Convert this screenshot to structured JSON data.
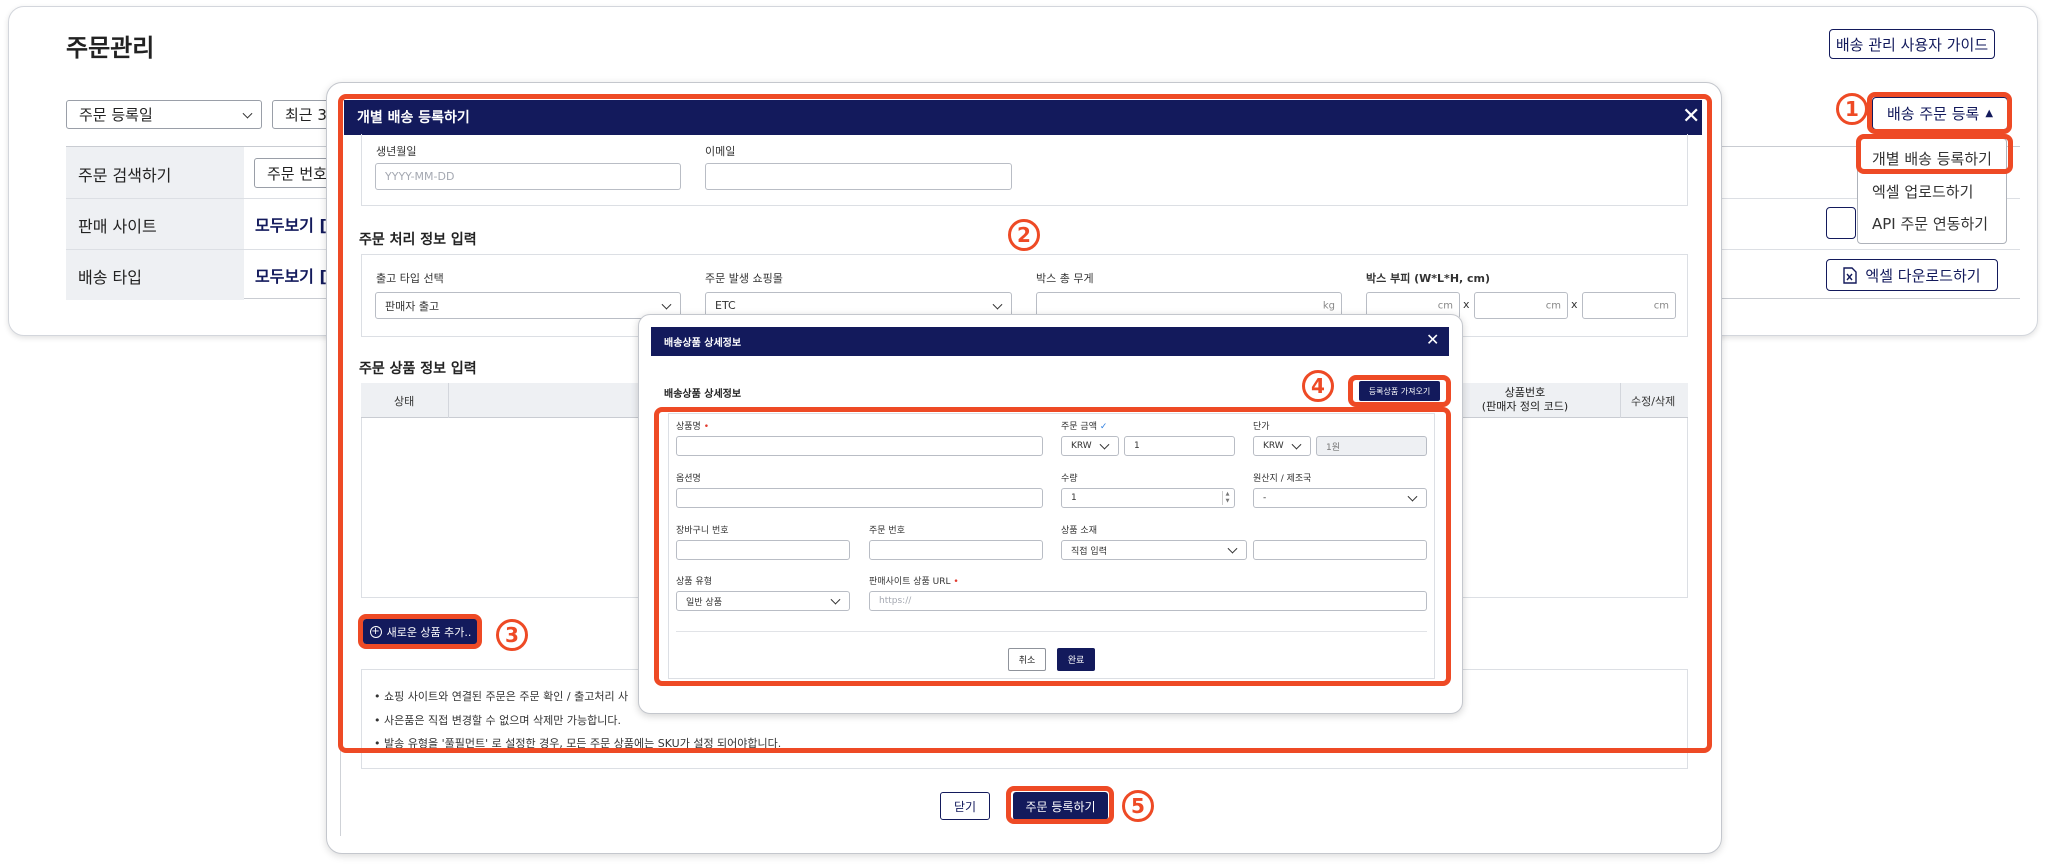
{
  "page": {
    "title": "주문관리",
    "guide_button": "배송 관리 사용자 가이드",
    "filter": {
      "date_type": "주문 등록일",
      "period_partial": "최근 3"
    },
    "search_rows": [
      {
        "label": "주문 검색하기",
        "value": "주문 번호"
      },
      {
        "label": "판매 사이트",
        "value": "모두보기 ["
      },
      {
        "label": "배송 타입",
        "value": "모두보기 ["
      }
    ],
    "register_button": "배송 주문 등록",
    "register_menu": [
      "개별 배송 등록하기",
      "엑셀 업로드하기",
      "API 주문 연동하기"
    ],
    "excel_download": "엑셀 다운로드하기"
  },
  "modal": {
    "title": "개별 배송 등록하기",
    "birth_label": "생년월일",
    "birth_placeholder": "YYYY-MM-DD",
    "email_label": "이메일",
    "process_section": "주문 처리 정보 입력",
    "release_type_label": "출고 타입 선택",
    "release_type_value": "판매자 출고",
    "mall_label": "주문 발생 쇼핑몰",
    "mall_value": "ETC",
    "weight_label": "박스 총 무게",
    "weight_unit": "kg",
    "volume_label": "박스 부피 (W*L*H, cm)",
    "volume_unit": "cm",
    "times": "x",
    "product_section": "주문 상품 정보 입력",
    "table_headers": {
      "status": "상태",
      "product_no": "상품번호",
      "product_no_sub": "(판매자 정의 코드)",
      "edit": "수정/삭제"
    },
    "add_product": "새로운 상품 추가..",
    "notes": [
      "• 쇼핑 사이트와 연결된 주문은 주문 확인 / 출고처리 사",
      "• 사은품은 직접 변경할 수 없으며 삭제만 가능합니다.",
      "• 발송 유형을 '풀필먼트' 로 설정한 경우, 모든 주문 상품에는 SKU가 설정 되어야합니다."
    ],
    "close_button": "닫기",
    "submit_button": "주문 등록하기"
  },
  "detail": {
    "title": "배송상품 상세정보",
    "section_title": "배송상품 상세정보",
    "import_button": "등록상품 가져오기",
    "product_name_label": "상품명",
    "order_amount_label": "주문 금액",
    "currency": "KRW",
    "order_amount_value": "1",
    "unit_price_label": "단가",
    "unit_price_value": "1원",
    "option_label": "옵션명",
    "quantity_label": "수량",
    "quantity_value": "1",
    "origin_label": "원산지 / 제조국",
    "origin_value": "-",
    "cart_no_label": "장바구니 번호",
    "order_no_label": "주문 번호",
    "material_label": "상품 소재",
    "material_value": "직접 입력",
    "product_type_label": "상품 유형",
    "product_type_value": "일반 상품",
    "url_label": "판매사이트 상품 URL",
    "url_placeholder": "https://",
    "cancel_button": "취소",
    "done_button": "완료"
  },
  "steps": [
    "1",
    "2",
    "3",
    "4",
    "5"
  ],
  "colors": {
    "navy": "#131a5c",
    "highlight": "#ee4a25",
    "required": "#e23b2e"
  }
}
